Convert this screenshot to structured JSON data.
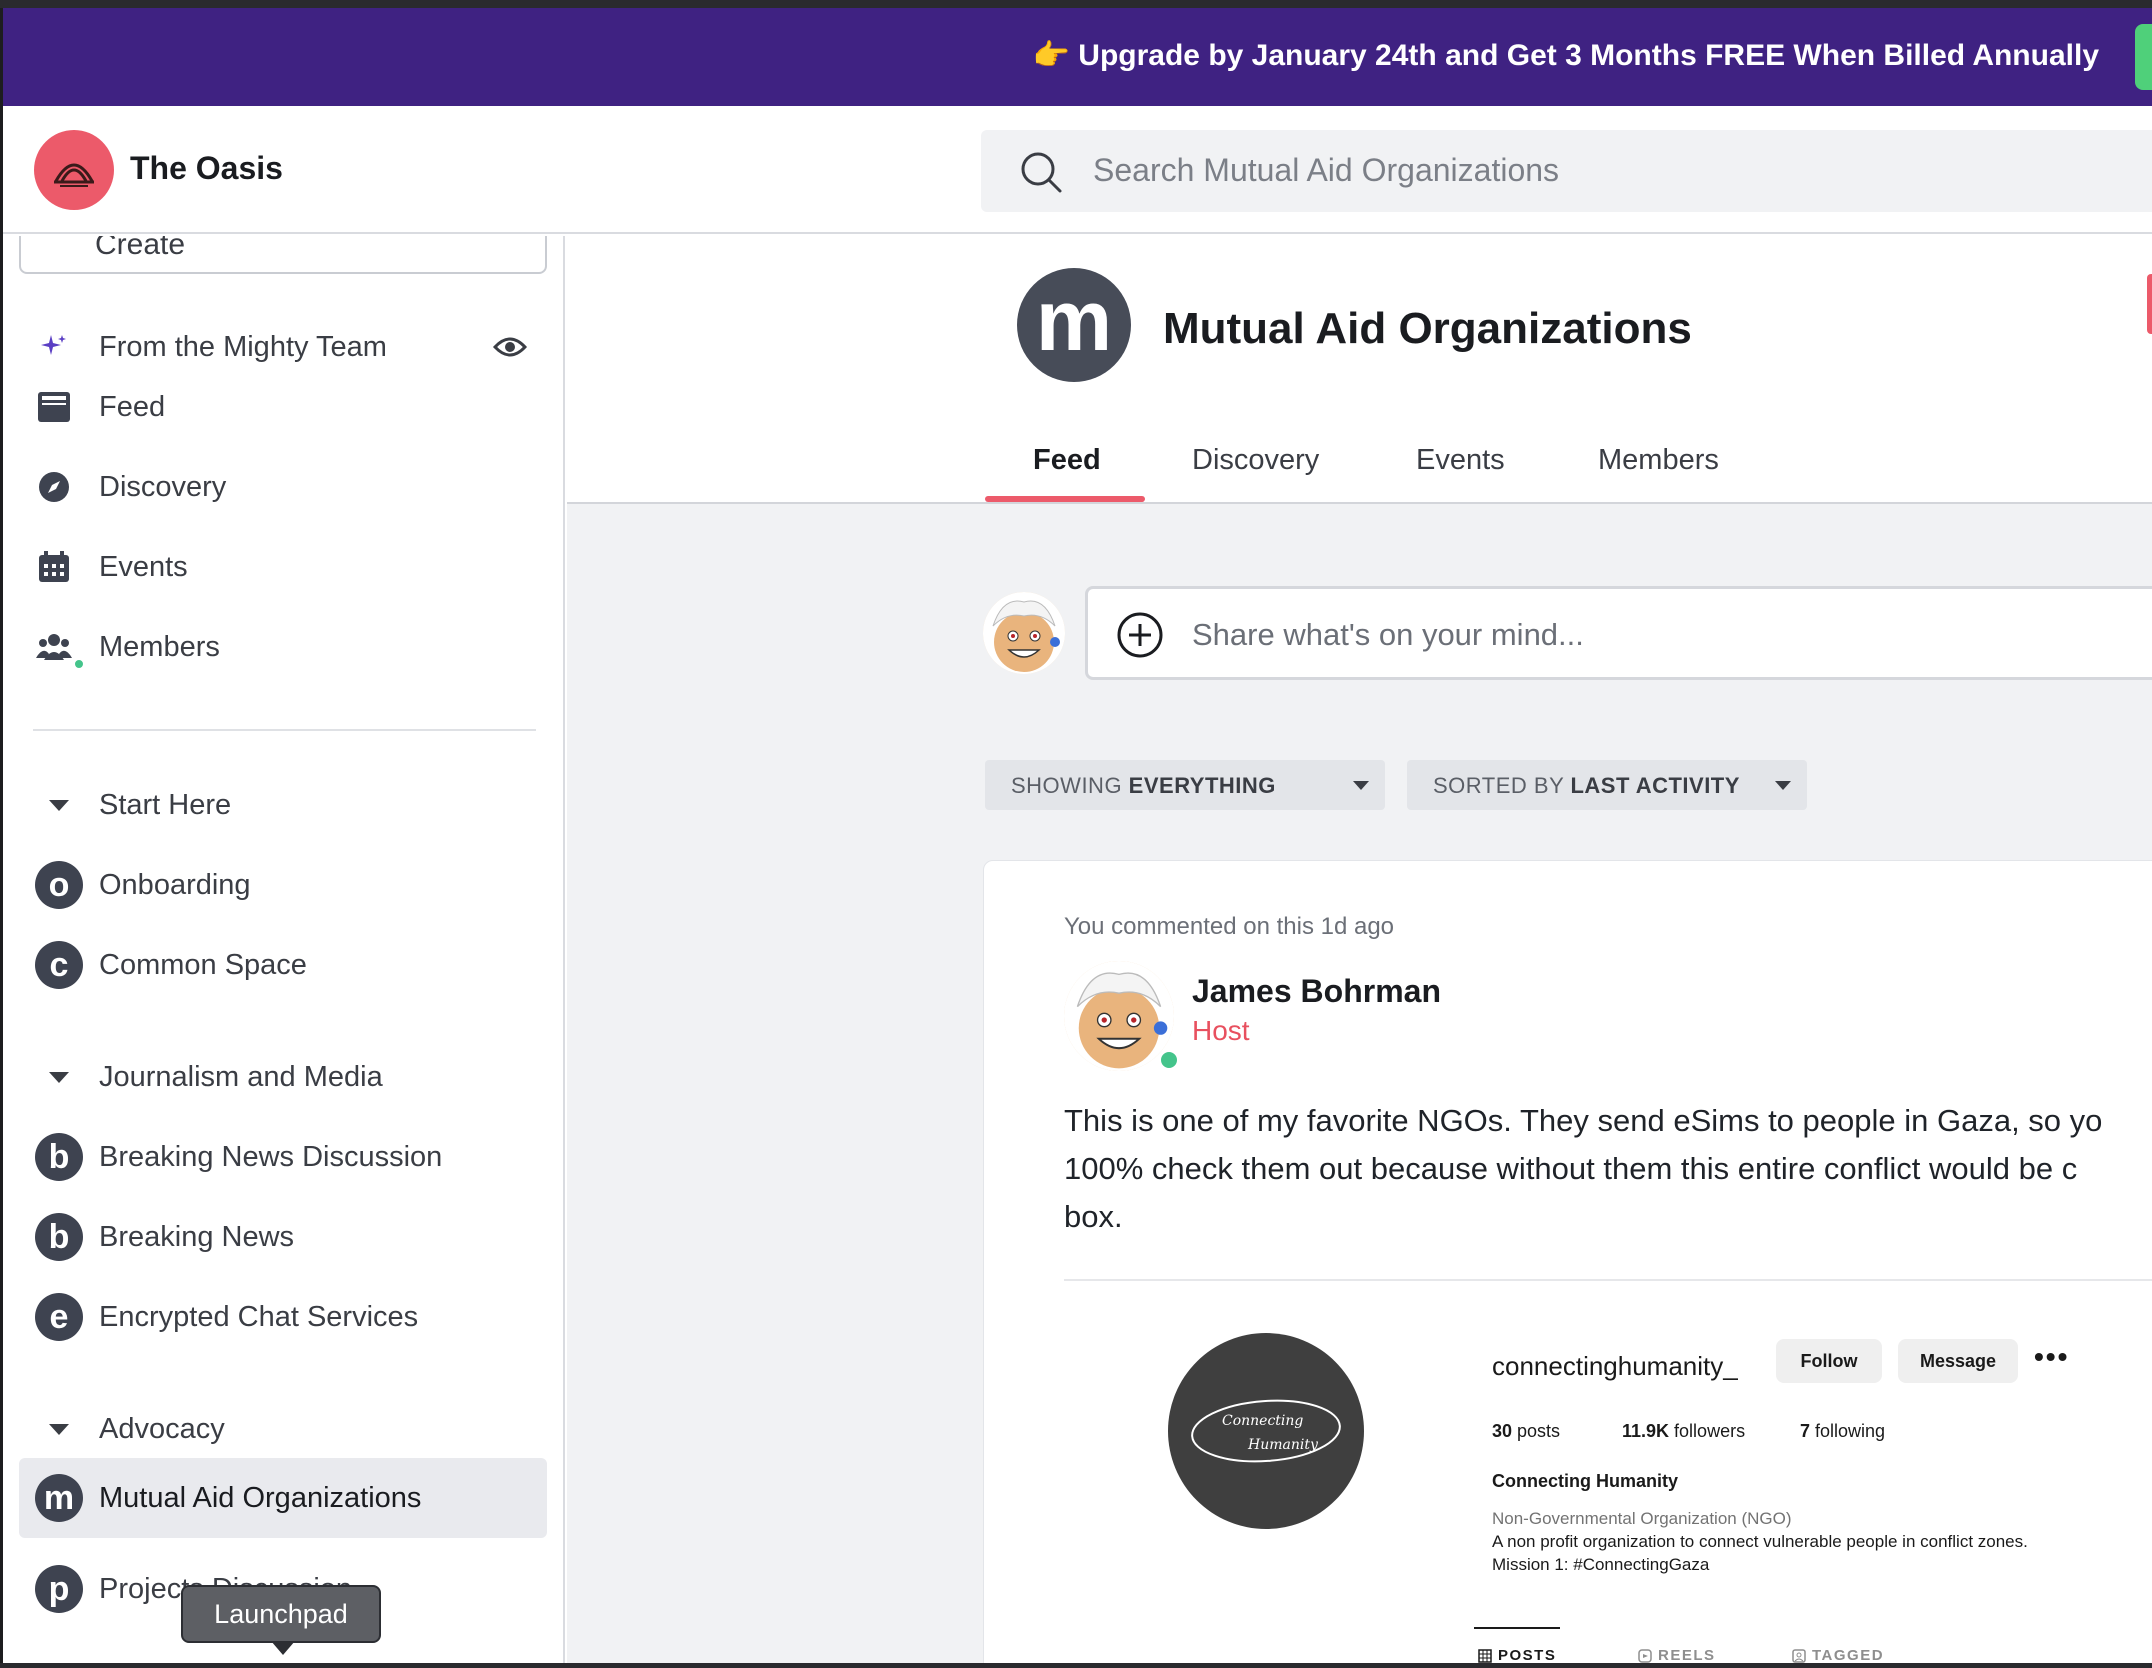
{
  "promo": {
    "emoji": "👉",
    "text": "Upgrade by January 24th and Get 3 Months FREE When Billed Annually"
  },
  "brand": {
    "name": "The Oasis"
  },
  "search": {
    "placeholder": "Search Mutual Aid Organizations"
  },
  "sidebar": {
    "create_label": "Create",
    "top_items": [
      {
        "label": "From the Mighty Team",
        "icon": "sparkle-icon"
      },
      {
        "label": "Feed",
        "icon": "feed-icon"
      },
      {
        "label": "Discovery",
        "icon": "compass-icon"
      },
      {
        "label": "Events",
        "icon": "calendar-icon"
      },
      {
        "label": "Members",
        "icon": "members-icon"
      }
    ],
    "sections": [
      {
        "title": "Start Here",
        "items": [
          {
            "letter": "o",
            "label": "Onboarding"
          },
          {
            "letter": "c",
            "label": "Common Space"
          }
        ]
      },
      {
        "title": "Journalism and Media",
        "items": [
          {
            "letter": "b",
            "label": "Breaking News Discussion"
          },
          {
            "letter": "b",
            "label": "Breaking News"
          },
          {
            "letter": "e",
            "label": "Encrypted Chat Services"
          }
        ]
      },
      {
        "title": "Advocacy",
        "items": [
          {
            "letter": "m",
            "label": "Mutual Aid Organizations"
          },
          {
            "letter": "p",
            "label": "Projects Discussion"
          }
        ]
      }
    ],
    "tooltip": "Launchpad"
  },
  "space": {
    "letter": "m",
    "title": "Mutual Aid Organizations",
    "tabs": [
      "Feed",
      "Discovery",
      "Events",
      "Members"
    ],
    "active_tab": "Feed"
  },
  "composer": {
    "placeholder": "Share what's on your mind..."
  },
  "filters": {
    "showing_prefix": "SHOWING ",
    "showing_value": "EVERYTHING",
    "sorted_prefix": "SORTED BY ",
    "sorted_value": "LAST ACTIVITY"
  },
  "post": {
    "meta": "You commented on this 1d ago",
    "author": "James Bohrman",
    "role": "Host",
    "body": "This is one of my favorite NGOs. They send eSims to people in Gaza, so yo\n100% check them out because without them this entire conflict would be c\nbox.",
    "embed": {
      "handle": "connectinghumanity_",
      "follow": "Follow",
      "message": "Message",
      "more": "•••",
      "posts": "30",
      "posts_label": " posts",
      "followers": "11.9K",
      "followers_label": " followers",
      "following": "7",
      "following_label": " following",
      "name": "Connecting Humanity",
      "category": "Non-Governmental Organization (NGO)",
      "description": "A non profit organization to connect vulnerable people in conflict zones.",
      "mission": "Mission 1: #ConnectingGaza",
      "logo_text_1": "Connecting",
      "logo_text_2": "Humanity",
      "tabs": [
        "POSTS",
        "REELS",
        "TAGGED"
      ]
    }
  },
  "colors": {
    "promo_bg": "#3f2282",
    "accent": "#ec5a6a",
    "host": "#e8505f",
    "online": "#44c48b"
  }
}
